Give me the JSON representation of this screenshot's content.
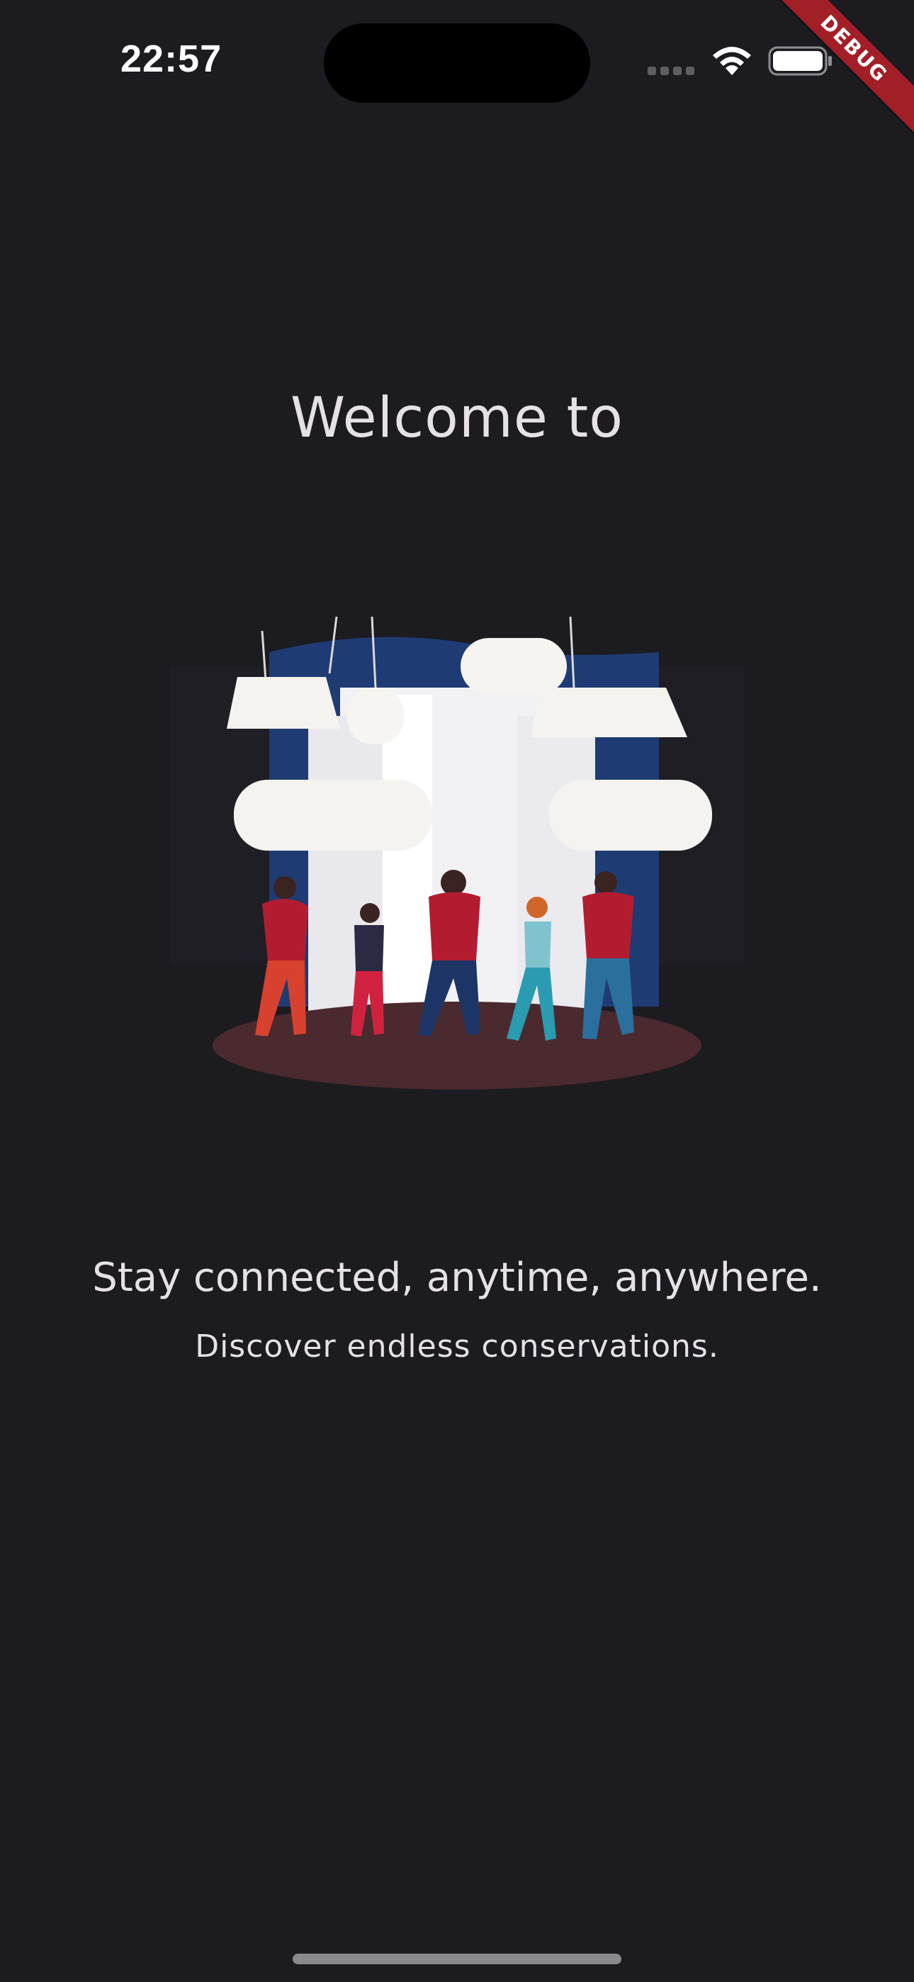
{
  "status_bar": {
    "time": "22:57"
  },
  "debug_banner": {
    "label": "DEBUG"
  },
  "welcome": {
    "title": "Welcome to",
    "tagline": "Stay connected, anytime, anywhere.",
    "subtagline": "Discover endless conservations."
  },
  "theme": {
    "background": "#1c1b20",
    "text": "#e6e1e6",
    "banner": "#a21f27"
  },
  "icons": [
    "signal-icon",
    "wifi-icon",
    "battery-icon"
  ]
}
